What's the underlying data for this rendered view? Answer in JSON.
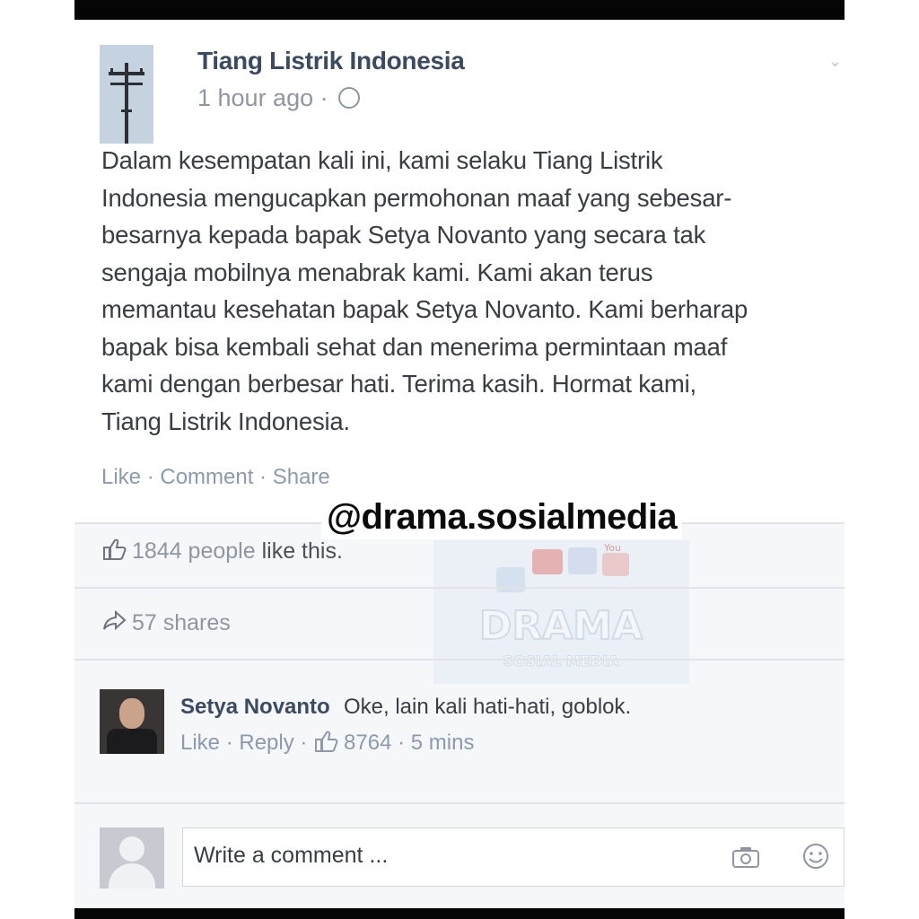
{
  "post": {
    "page_name": "Tiang Listrik Indonesia",
    "timestamp": "1 hour ago",
    "separator": "·",
    "body_lines": [
      "Dalam kesempatan kali ini, kami selaku Tiang Listrik",
      "Indonesia mengucapkan permohonan maaf yang sebesar-",
      "besarnya kepada bapak Setya Novanto yang secara tak",
      "sengaja mobilnya menabrak kami. Kami akan terus",
      "memantau kesehatan bapak Setya Novanto. Kami berharap",
      "bapak bisa kembali sehat dan menerima permintaan maaf",
      "kami dengan berbesar hati. Terima kasih. Hormat kami,",
      "Tiang Listrik Indonesia."
    ],
    "actions": {
      "like": "Like",
      "comment": "Comment",
      "share": "Share",
      "sep": " · "
    }
  },
  "watermark": {
    "handle": "@drama.sosialmedia",
    "logo_text": "DRAMA",
    "logo_sub": "SOSIAL MEDIA",
    "logo_badge": "You"
  },
  "stats": {
    "likes_count": "1844 people",
    "likes_suffix": "like this.",
    "shares": "57 shares"
  },
  "comment": {
    "author": "Setya Novanto",
    "text": "Oke, lain kali hati-hati, goblok.",
    "like": "Like",
    "reply": "Reply",
    "likes_count": "8764",
    "time": "5 mins",
    "sep": " · "
  },
  "composer": {
    "placeholder": "Write a comment ..."
  },
  "icons": {
    "globe": "globe-icon",
    "thumb": "thumbs-up-icon",
    "share": "share-arrow-icon",
    "camera": "camera-icon",
    "smiley": "smiley-icon"
  },
  "colors": {
    "name_blue": "#3b4a63",
    "meta_gray": "#8f96a3",
    "link_gray": "#8b9aae"
  }
}
